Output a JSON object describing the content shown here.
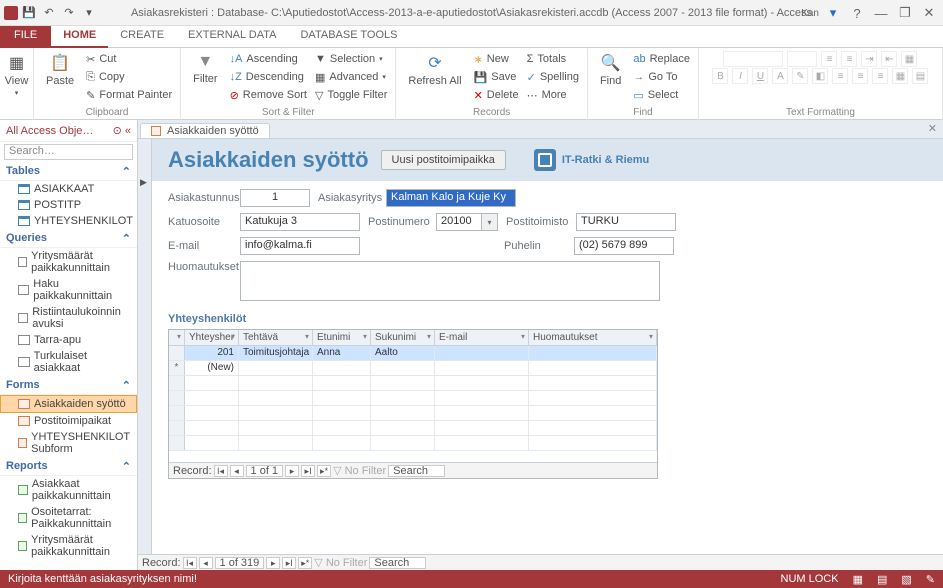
{
  "title": "Asiakasrekisteri : Database- C:\\Aputiedostot\\Access-2013-a-e-aputiedostot\\Asiakasrekisteri.accdb (Access 2007 - 2013 file format) - Access",
  "lang": "Kan",
  "tabs": {
    "file": "FILE",
    "home": "HOME",
    "create": "CREATE",
    "external": "EXTERNAL DATA",
    "dbtools": "DATABASE TOOLS"
  },
  "ribbon": {
    "view": "View",
    "paste": "Paste",
    "cut": "Cut",
    "copy": "Copy",
    "fpainter": "Format Painter",
    "clipboard": "Clipboard",
    "filter": "Filter",
    "asc": "Ascending",
    "desc": "Descending",
    "rmsort": "Remove Sort",
    "selection": "Selection",
    "advanced": "Advanced",
    "toggle": "Toggle Filter",
    "sortfilter": "Sort & Filter",
    "refresh": "Refresh All",
    "new": "New",
    "save": "Save",
    "delete": "Delete",
    "totals": "Totals",
    "spelling": "Spelling",
    "more": "More",
    "records": "Records",
    "find": "Find",
    "replace": "Replace",
    "goto": "Go To",
    "select": "Select",
    "findg": "Find",
    "textfmt": "Text Formatting"
  },
  "sidebar": {
    "title": "All Access Obje…",
    "search": "Search…",
    "tables": "Tables",
    "t1": "ASIAKKAAT",
    "t2": "POSTITP",
    "t3": "YHTEYSHENKILOT",
    "queries": "Queries",
    "q1": "Yritysmäärät paikkakunnittain",
    "q2": "Haku paikkakunnittain",
    "q3": "Ristiintaulukoinnin avuksi",
    "q4": "Tarra-apu",
    "q5": "Turkulaiset asiakkaat",
    "forms": "Forms",
    "f1": "Asiakkaiden syöttö",
    "f2": "Postitoimipaikat",
    "f3": "YHTEYSHENKILOT Subform",
    "reports": "Reports",
    "r1": "Asiakkaat paikkakunnittain",
    "r2": "Osoitetarrat: Paikkakunnittain",
    "r3": "Yritysmäärät paikkakunnittain"
  },
  "docTab": "Asiakkaiden syöttö",
  "form": {
    "title": "Asiakkaiden syöttö",
    "btn": "Uusi postitoimipaikka",
    "brand": "IT-Ratki & Riemu",
    "l_id": "Asiakastunnus",
    "v_id": "1",
    "l_yr": "Asiakasyritys",
    "v_yr": "Kalman Kalo ja Kuje Ky",
    "l_katu": "Katuosoite",
    "v_katu": "Katukuja 3",
    "l_pn": "Postinumero",
    "v_pn": "20100",
    "l_pt": "Postitoimisto",
    "v_pt": "TURKU",
    "l_email": "E-mail",
    "v_email": "info@kalma.fi",
    "l_puh": "Puhelin",
    "v_puh": "(02) 5679 899",
    "l_huom": "Huomautukset",
    "sub_title": "Yhteyshenkilöt",
    "cols": {
      "c1": "Yhteysher",
      "c2": "Tehtävä",
      "c3": "Etunimi",
      "c4": "Sukunimi",
      "c5": "E-mail",
      "c6": "Huomautukset"
    },
    "row": {
      "id": "201",
      "teht": "Toimitusjohtaja",
      "etu": "Anna",
      "suku": "Aalto"
    },
    "newrow": "(New)"
  },
  "nav": {
    "rec": "Record:",
    "p1": "1 of 1",
    "p2": "1 of 319",
    "nofilter": "No Filter",
    "search": "Search"
  },
  "status": {
    "msg": "Kirjoita kenttään asiakasyrityksen nimi!",
    "lock": "NUM LOCK"
  }
}
